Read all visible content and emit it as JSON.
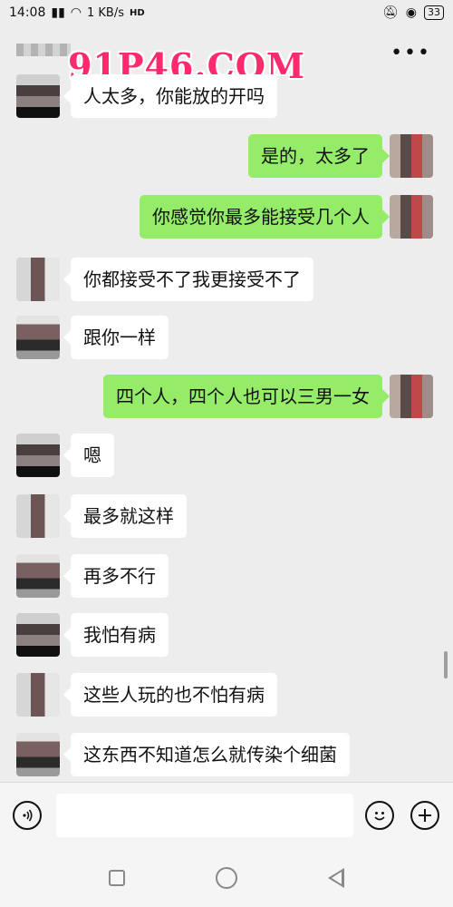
{
  "status_bar": {
    "time": "14:08",
    "signal_text": "1 KB/s",
    "hd_label": "HD",
    "battery": "33"
  },
  "header": {
    "watermark": "91P46.COM",
    "more_icon": "more-icon"
  },
  "messages": [
    {
      "side": "left",
      "text": "人太多，你能放的开吗"
    },
    {
      "side": "right",
      "text": "是的，太多了"
    },
    {
      "side": "right",
      "text": "你感觉你最多能接受几个人"
    },
    {
      "side": "left",
      "text": "你都接受不了我更接受不了"
    },
    {
      "side": "left",
      "text": "跟你一样"
    },
    {
      "side": "right",
      "text": "四个人，四个人也可以三男一女"
    },
    {
      "side": "left",
      "text": "嗯"
    },
    {
      "side": "left",
      "text": "最多就这样"
    },
    {
      "side": "left",
      "text": "再多不行"
    },
    {
      "side": "left",
      "text": "我怕有病"
    },
    {
      "side": "left",
      "text": "这些人玩的也不怕有病"
    },
    {
      "side": "left",
      "text": "这东西不知道怎么就传染个细菌"
    }
  ],
  "input_bar": {
    "voice_icon": "voice-icon",
    "emoji_icon": "emoji-icon",
    "plus_icon": "plus-icon",
    "placeholder": ""
  },
  "nav_bar": {
    "recent_icon": "recent-apps-icon",
    "home_icon": "home-icon",
    "back_icon": "back-icon"
  }
}
